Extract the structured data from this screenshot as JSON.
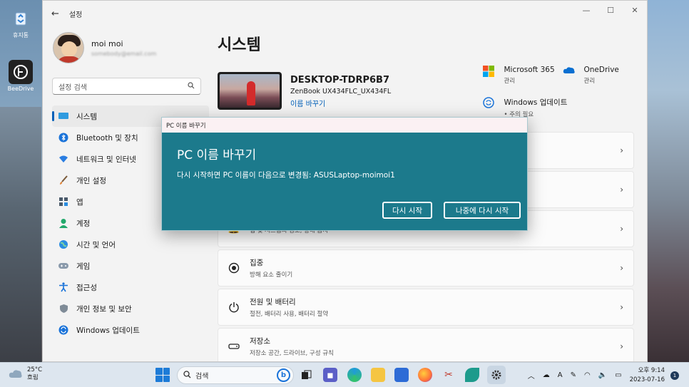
{
  "desktop": {
    "icons": [
      {
        "label": "휴지통"
      },
      {
        "label": "BeeDrive"
      }
    ]
  },
  "window": {
    "title": "설정",
    "back_glyph": "←",
    "controls": {
      "minimize": "—",
      "maximize": "☐",
      "close": "✕"
    }
  },
  "profile": {
    "name": "moi moi",
    "email": "​somebody@email.com"
  },
  "search": {
    "placeholder": "설정 검색",
    "icon": "search-icon"
  },
  "nav": {
    "items": [
      {
        "label": "시스템",
        "icon": "monitor-icon",
        "active": true
      },
      {
        "label": "Bluetooth 및 장치",
        "icon": "bluetooth-icon"
      },
      {
        "label": "네트워크 및 인터넷",
        "icon": "wifi-icon"
      },
      {
        "label": "개인 설정",
        "icon": "brush-icon"
      },
      {
        "label": "앱",
        "icon": "apps-icon"
      },
      {
        "label": "계정",
        "icon": "account-icon"
      },
      {
        "label": "시간 및 언어",
        "icon": "globe-icon"
      },
      {
        "label": "게임",
        "icon": "gamepad-icon"
      },
      {
        "label": "접근성",
        "icon": "accessibility-icon"
      },
      {
        "label": "개인 정보 및 보안",
        "icon": "shield-icon"
      },
      {
        "label": "Windows 업데이트",
        "icon": "update-icon"
      }
    ]
  },
  "main": {
    "title": "시스템",
    "device": {
      "name": "DESKTOP-TDRP6B7",
      "model": "ZenBook UX434FLC_UX434FL",
      "rename": "이름 바꾸기"
    },
    "quick": [
      {
        "title": "Microsoft 365",
        "sub": "관리",
        "icon": "microsoft-365-icon"
      },
      {
        "title": "OneDrive",
        "sub": "관리",
        "icon": "onedrive-icon"
      },
      {
        "title": "Windows 업데이트",
        "sub": "• 주의 필요",
        "icon": "update-icon"
      }
    ],
    "cards": [
      {
        "title": "",
        "sub": "",
        "icon": ""
      },
      {
        "title": "",
        "sub": "",
        "icon": ""
      },
      {
        "title": "",
        "sub": "앱 및 시스템의 경고, 방해 금지",
        "icon": "bell-icon"
      },
      {
        "title": "집중",
        "sub": "방해 요소 줄이기",
        "icon": "focus-icon"
      },
      {
        "title": "전원 및 배터리",
        "sub": "절전, 배터리 사용, 배터리 절약",
        "icon": "power-icon"
      },
      {
        "title": "저장소",
        "sub": "저장소 공간, 드라이브, 구성 규칙",
        "icon": "storage-icon"
      }
    ]
  },
  "dialog": {
    "window_title": "PC 이름 바꾸기",
    "heading": "PC 이름 바꾸기",
    "message": "다시 시작하면 PC 이름이 다음으로 변경됨: ASUSLaptop-moimoi1",
    "restart_now": "다시 시작",
    "restart_later": "나중에 다시 시작"
  },
  "taskbar": {
    "weather_temp": "25°C",
    "weather_desc": "흐림",
    "search_label": "검색",
    "time": "오후 9:14",
    "date": "2023-07-16",
    "notification_count": "1"
  },
  "colors": {
    "accent": "#005fb8",
    "dialog_bg": "#1c7a8c",
    "dialog_titlebar": "#fbf1f3"
  }
}
